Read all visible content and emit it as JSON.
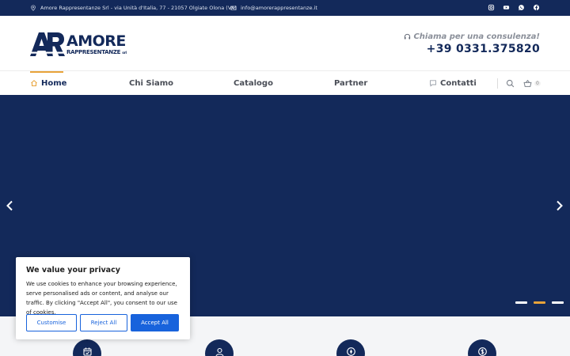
{
  "topbar": {
    "address": "Amore Rappresentanze Srl - via Unità d'Italia, 77 - 21057 Olgiate Olona (VA)",
    "email": "info@amorerappresentanze.it",
    "social_icons": [
      "instagram-icon",
      "youtube-icon",
      "whatsapp-icon",
      "facebook-icon"
    ]
  },
  "header": {
    "logo_name": "AMORE",
    "logo_sub": "RAPPRESENTANZE",
    "logo_srl": "srl",
    "consult_label": "Chiama per una consulenza!",
    "phone": "+39 0331.375820"
  },
  "nav": {
    "items": [
      {
        "label": "Home",
        "icon": "home-icon",
        "active": true
      },
      {
        "label": "Chi Siamo"
      },
      {
        "label": "Catalogo"
      },
      {
        "label": "Partner"
      },
      {
        "label": "Contatti",
        "icon": "chat-icon"
      }
    ],
    "cart_count": "0"
  },
  "slider": {
    "slides": 3,
    "active_slide": 2
  },
  "cookie": {
    "title": "We value your privacy",
    "text": "We use cookies to enhance your browsing experience, serve personalised ads or content, and analyse our traffic. By clicking \"Accept All\", you consent to our use of cookies.",
    "customise": "Customise",
    "reject": "Reject All",
    "accept": "Accept All"
  },
  "features": [
    "calendar-icon",
    "user-pin-icon",
    "compass-icon",
    "dollar-icon"
  ],
  "colors": {
    "navy": "#13295a",
    "accent": "#e8a33a",
    "cookie_blue": "#1863dc"
  }
}
